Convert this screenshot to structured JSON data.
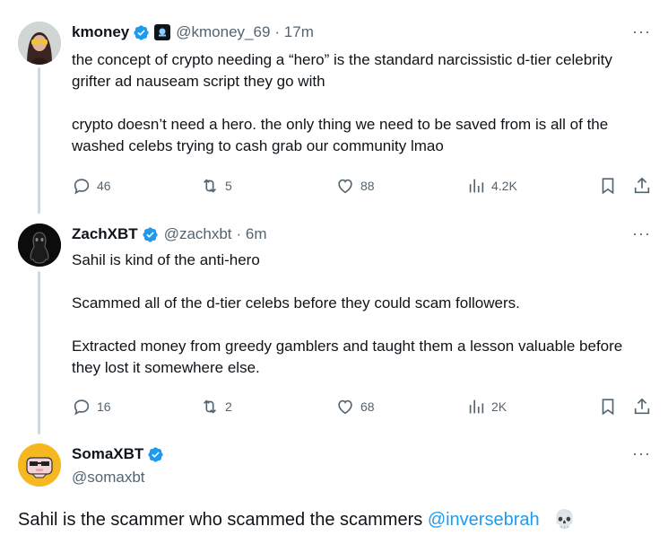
{
  "tweets": [
    {
      "name": "kmoney",
      "handle": "@kmoney_69",
      "time": "· 17m",
      "paragraphs": [
        "the concept of crypto needing a “hero” is the standard narcissistic d-tier celebrity grifter ad nauseam script they go with",
        "crypto doesn’t need a hero. the only thing we need to be saved from is all of the washed celebs trying to cash grab our community lmao"
      ],
      "replies": "46",
      "reposts": "5",
      "likes": "88",
      "views": "4.2K"
    },
    {
      "name": "ZachXBT",
      "handle": "@zachxbt",
      "time": "· 6m",
      "paragraphs": [
        "Sahil is kind of the anti-hero",
        "Scammed all of the d-tier celebs before they could scam followers.",
        "Extracted money from greedy gamblers and taught them a lesson valuable before they lost it somewhere else."
      ],
      "replies": "16",
      "reposts": "2",
      "likes": "68",
      "views": "2K"
    }
  ],
  "main_tweet": {
    "name": "SomaXBT",
    "handle": "@somaxbt",
    "text": "Sahil is the scammer who scammed the scammers",
    "mention": "@inversebrah",
    "emoji": "💀"
  },
  "more_label": "···",
  "icons": [
    "reply-icon",
    "repost-icon",
    "like-icon",
    "views-icon",
    "bookmark-icon",
    "share-icon",
    "verified-badge-icon",
    "more-icon",
    "skull-emoji"
  ],
  "colors": {
    "accent": "#1d9bf0",
    "text": "#0f1419",
    "muted": "#536471",
    "line": "#cfd9de"
  }
}
